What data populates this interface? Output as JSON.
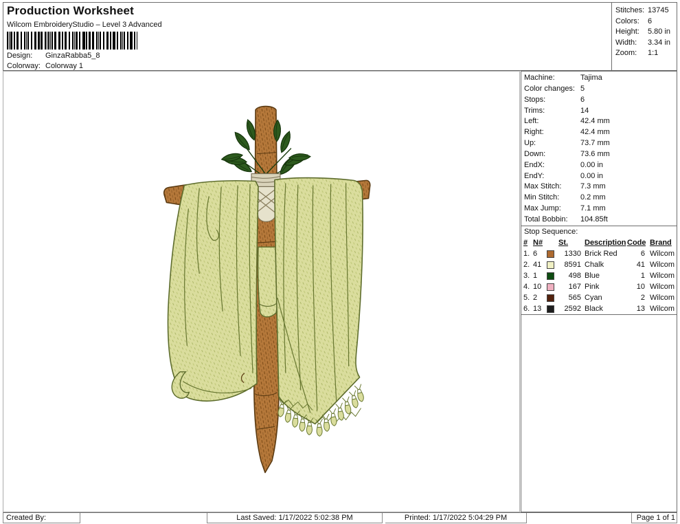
{
  "header": {
    "title": "Production Worksheet",
    "subtitle": "Wilcom EmbroideryStudio – Level 3 Advanced",
    "design_label": "Design:",
    "design_value": "GinzaRabba5_8",
    "colorway_label": "Colorway:",
    "colorway_value": "Colorway 1",
    "stats": [
      {
        "label": "Stitches:",
        "value": "13745"
      },
      {
        "label": "Colors:",
        "value": "6"
      },
      {
        "label": "Height:",
        "value": "5.80 in"
      },
      {
        "label": "Width:",
        "value": "3.34 in"
      },
      {
        "label": "Zoom:",
        "value": "1:1"
      }
    ]
  },
  "machine_info": {
    "rows": [
      {
        "label": "Machine:",
        "value": "Tajima"
      },
      {
        "label": "Color changes:",
        "value": "5"
      },
      {
        "label": "Stops:",
        "value": "6"
      },
      {
        "label": "Trims:",
        "value": "14"
      },
      {
        "label": "Left:",
        "value": "42.4 mm"
      },
      {
        "label": "Right:",
        "value": "42.4 mm"
      },
      {
        "label": "Up:",
        "value": "73.7 mm"
      },
      {
        "label": "Down:",
        "value": "73.6 mm"
      },
      {
        "label": "EndX:",
        "value": "0.00 in"
      },
      {
        "label": "EndY:",
        "value": "0.00 in"
      },
      {
        "label": "Max Stitch:",
        "value": "7.3 mm"
      },
      {
        "label": "Min Stitch:",
        "value": "0.2 mm"
      },
      {
        "label": "Max Jump:",
        "value": "7.1 mm"
      },
      {
        "label": "Total Bobbin:",
        "value": "104.85ft"
      }
    ]
  },
  "stop_sequence": {
    "label": "Stop Sequence:",
    "headers": [
      "#",
      "N#",
      "St.",
      "Description",
      "Code",
      "Brand"
    ],
    "rows": [
      {
        "num": "1.",
        "n": "6",
        "color": "#ad6a30",
        "st": "1330",
        "desc": "Brick Red",
        "code": "6",
        "brand": "Wilcom"
      },
      {
        "num": "2.",
        "n": "41",
        "color": "#f0f0c4",
        "st": "8591",
        "desc": "Chalk",
        "code": "41",
        "brand": "Wilcom"
      },
      {
        "num": "3.",
        "n": "1",
        "color": "#0e4c12",
        "st": "498",
        "desc": "Blue",
        "code": "1",
        "brand": "Wilcom"
      },
      {
        "num": "4.",
        "n": "10",
        "color": "#efb0c0",
        "st": "167",
        "desc": "Pink",
        "code": "10",
        "brand": "Wilcom"
      },
      {
        "num": "5.",
        "n": "2",
        "color": "#53220e",
        "st": "565",
        "desc": "Cyan",
        "code": "2",
        "brand": "Wilcom"
      },
      {
        "num": "6.",
        "n": "13",
        "color": "#1e1e1e",
        "st": "2592",
        "desc": "Black",
        "code": "13",
        "brand": "Wilcom"
      }
    ]
  },
  "artwork_colors": {
    "cloth": "#dadd9d",
    "cloth_outline": "#5d6c2c",
    "wood": "#b5783a",
    "wood_outline": "#5a3a12",
    "leaf": "#2d5a1e",
    "rope": "#d9d3ba"
  },
  "footer": {
    "created_by": "Created By:",
    "last_saved": "Last Saved: 1/17/2022 5:02:38 PM",
    "printed": "Printed: 1/17/2022 5:04:29 PM",
    "page": "Page 1 of 1"
  }
}
